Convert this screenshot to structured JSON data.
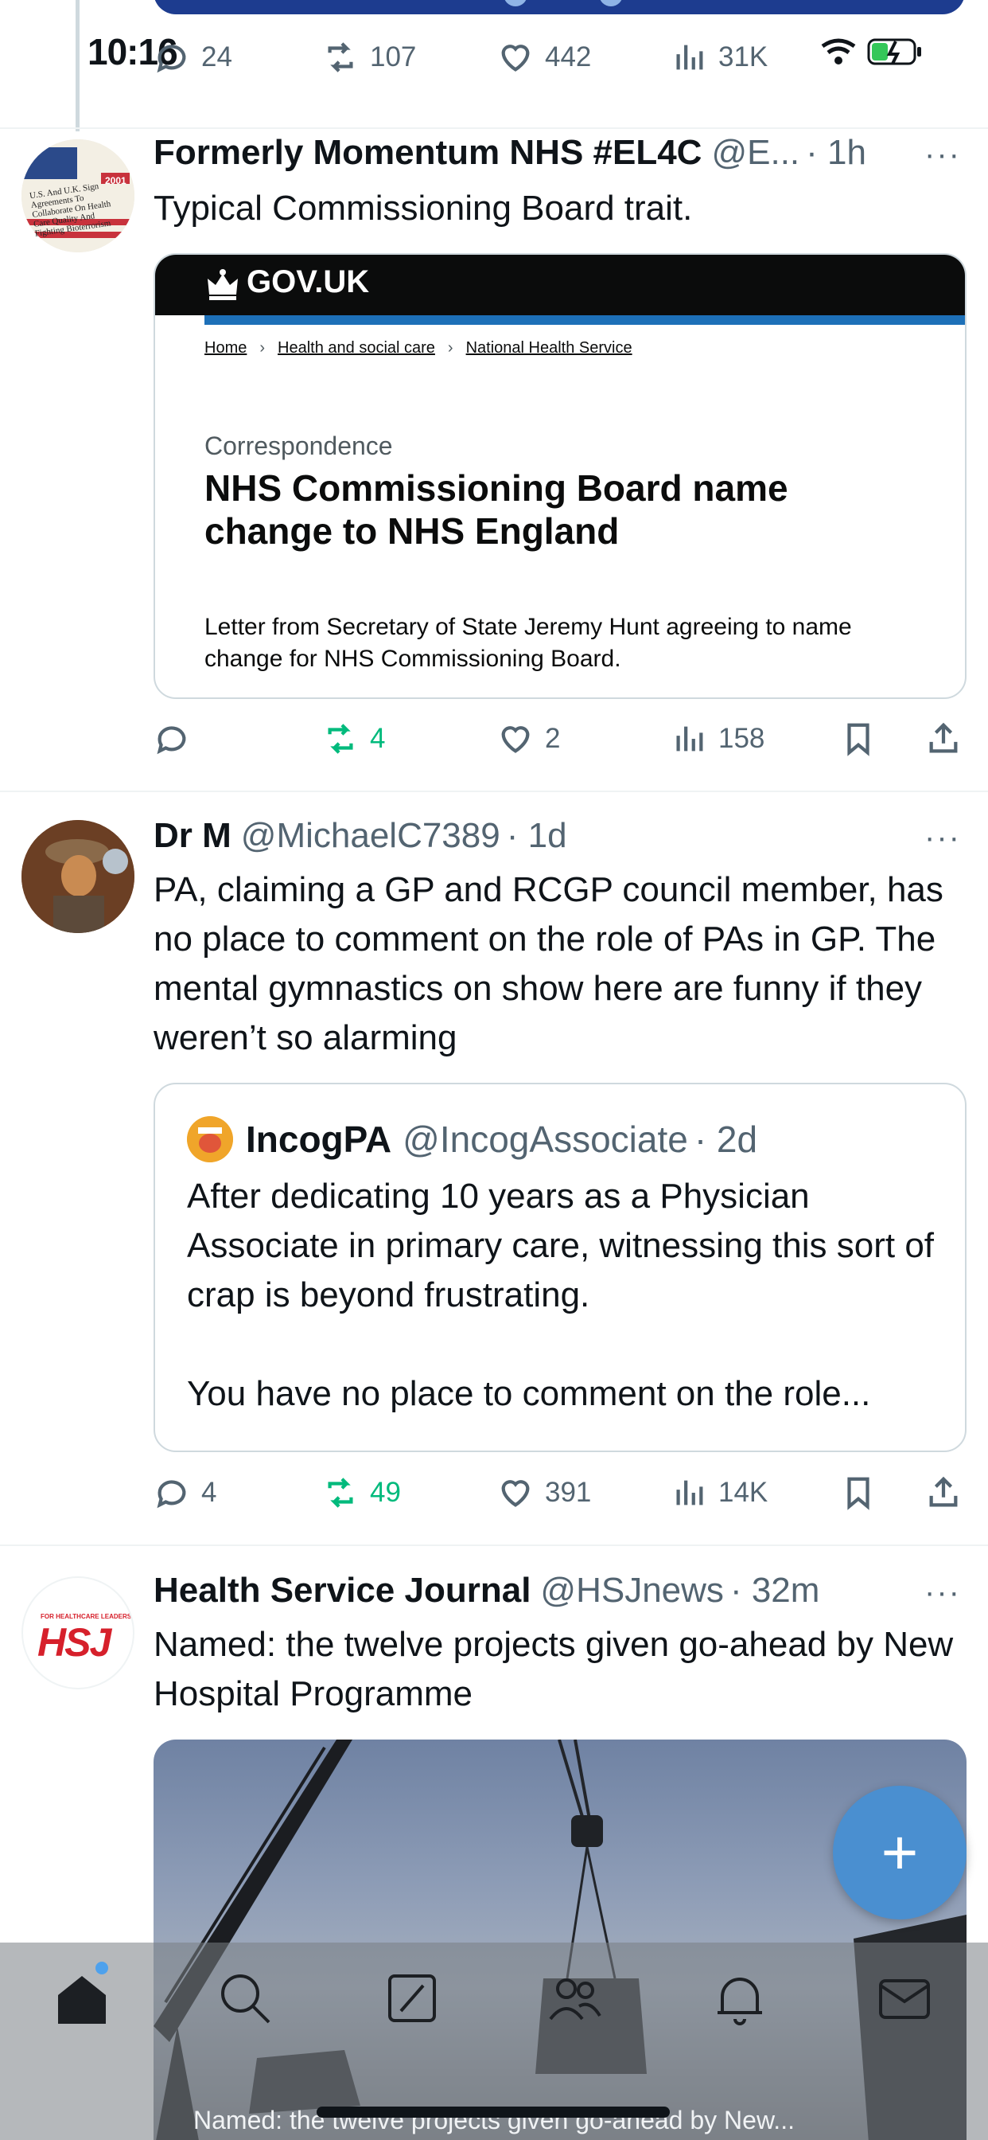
{
  "status_bar": {
    "time": "10:16"
  },
  "top_tweet_actions": {
    "replies": "24",
    "reposts": "107",
    "likes": "442",
    "views": "31K"
  },
  "tweets": [
    {
      "name": "Formerly Momentum NHS #EL4C",
      "handle": "@E...",
      "time": "· 1h",
      "text": "Typical Commissioning Board trait.",
      "avatar_text": "U.S. And U.K. Sign Agreements To Collaborate On Health Care Quality And Fighting Bioterrorism",
      "avatar_year": "2001",
      "card": {
        "brand": "GOV.UK",
        "breadcrumbs": [
          "Home",
          "Health and social care",
          "National Health Service"
        ],
        "label": "Correspondence",
        "title": "NHS Commissioning Board name change to NHS England",
        "description": "Letter from Secretary of State Jeremy Hunt agreeing to name change for NHS Commissioning Board."
      },
      "actions": {
        "replies": "",
        "reposts": "4",
        "likes": "2",
        "views": "158"
      }
    },
    {
      "name": "Dr M",
      "handle": "@MichaelC7389",
      "time": "· 1d",
      "text": "PA, claiming a GP and RCGP council member, has no place to comment on the role of PAs in GP.  The mental gymnastics on show here are funny if they weren’t so alarming",
      "quote": {
        "name": "IncogPA",
        "handle": "@IncogAssociate",
        "time": "· 2d",
        "text_line1": "After dedicating 10 years as a Physician Associate in primary care, witnessing this sort of crap is beyond frustrating.",
        "text_line2": "You have no place to comment on the role..."
      },
      "actions": {
        "replies": "4",
        "reposts": "49",
        "likes": "391",
        "views": "14K"
      }
    },
    {
      "name": "Health Service Journal",
      "handle": "@HSJnews",
      "time": "· 32m",
      "text": "Named: the twelve projects given go-ahead by New Hospital Programme",
      "avatar_small": "FOR HEALTHCARE LEADERS",
      "avatar_logo": "HSJ",
      "media_caption": "Named: the twelve projects given go-ahead by New..."
    }
  ],
  "more_label": "···",
  "fab_label": "+",
  "tabs": [
    "home",
    "search",
    "grok",
    "communities",
    "notifications",
    "messages"
  ],
  "colors": {
    "repost_green": "#00ba7c",
    "accent_blue": "#1d9bf0",
    "gov_blue": "#1d70b8",
    "hsj_red": "#d6202b"
  }
}
